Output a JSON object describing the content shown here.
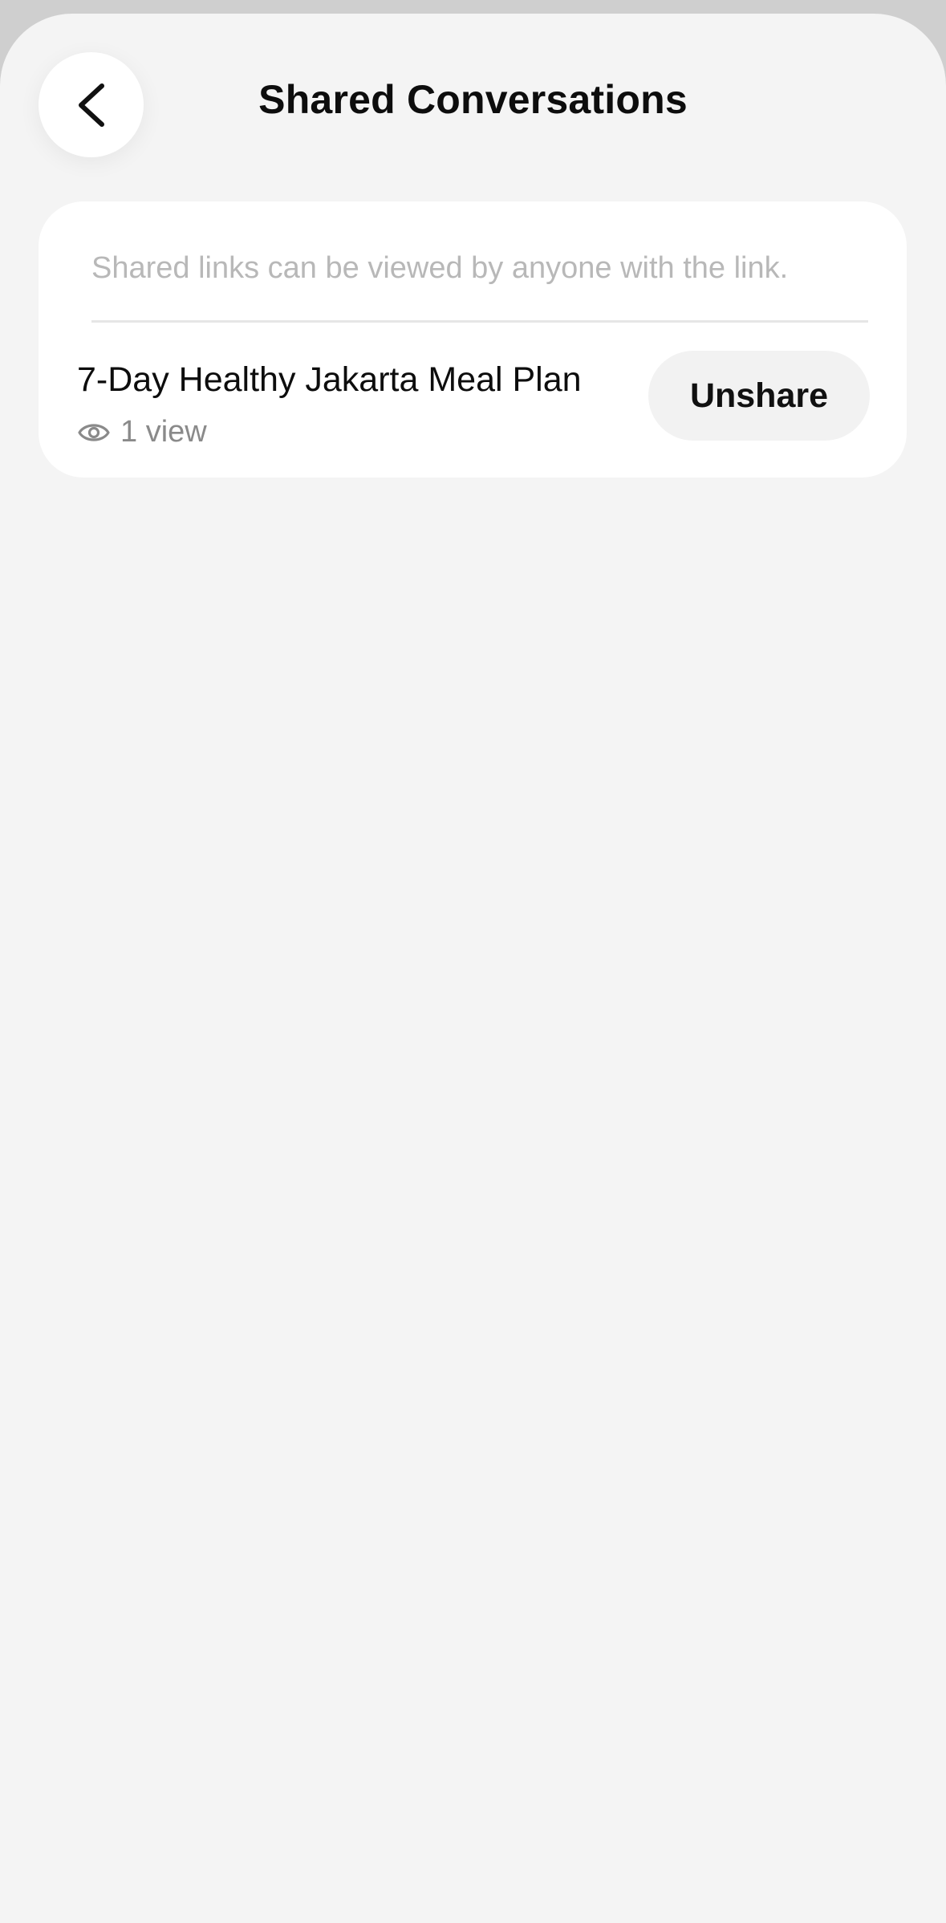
{
  "header": {
    "title": "Shared Conversations",
    "back_icon": "chevron-left-icon"
  },
  "card": {
    "note": "Shared links can be viewed by anyone with the link.",
    "items": [
      {
        "title": "7-Day Healthy Jakarta Meal Plan",
        "views": "1 view",
        "views_icon": "eye-icon",
        "action_label": "Unshare"
      }
    ]
  },
  "colors": {
    "background": "#f4f4f4",
    "card": "#ffffff",
    "text_primary": "#0d0d0d",
    "text_secondary": "#8a8a8a",
    "note_text": "#b8b8b8",
    "button_bg": "#f2f2f2"
  }
}
